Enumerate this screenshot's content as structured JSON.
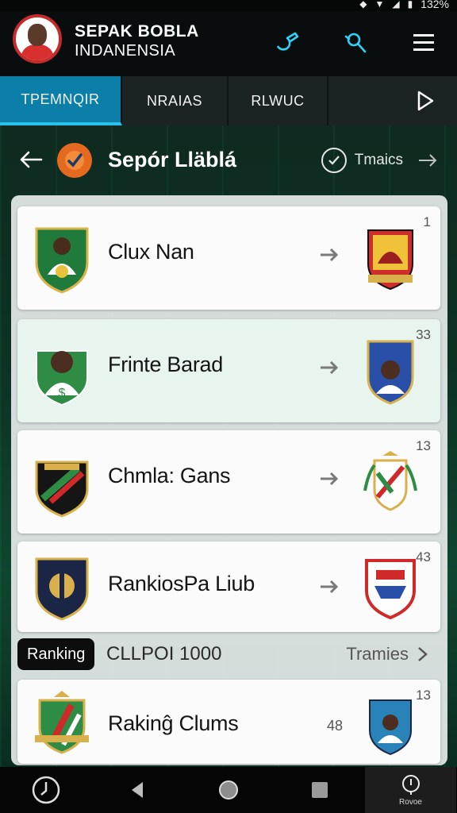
{
  "status_bar": {
    "text": "132%"
  },
  "app": {
    "title_line1": "SEPAK BOBLA",
    "title_line2": "INDANENSIA"
  },
  "tabs": [
    {
      "label": "TPEMNQIR",
      "active": true
    },
    {
      "label": "NRAIAS",
      "active": false
    },
    {
      "label": "RLWUC",
      "active": false
    }
  ],
  "section": {
    "title": "Sepór Lläblá",
    "right_label": "Tmaics"
  },
  "clubs": [
    {
      "name": "Clux Nan",
      "rank": "1"
    },
    {
      "name": "Frinte Barad",
      "rank": "33",
      "highlight": true
    },
    {
      "name": "Chmla: Gans",
      "rank": "13"
    },
    {
      "name": "RankiosPa Liub",
      "rank": "43"
    }
  ],
  "ranking_bar": {
    "pill": "Ranking",
    "text": "CLLPOI 1000",
    "right_label": "Tramies"
  },
  "last_club": {
    "name": "Rakinĝ Clums",
    "rank": "13",
    "extra": "48"
  },
  "nav": {
    "last_label": "Rovoe"
  },
  "colors": {
    "tab_active": "#0b7fa8",
    "accent": "#27c1f0",
    "background_green": "#0c3325"
  }
}
